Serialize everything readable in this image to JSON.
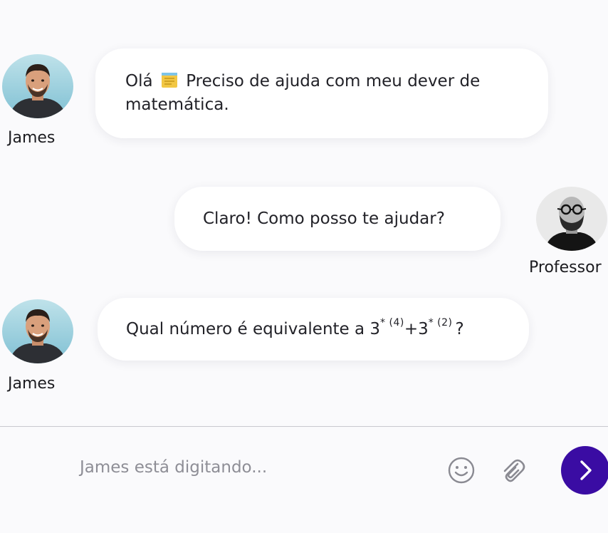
{
  "colors": {
    "background": "#fafafc",
    "bubble": "#ffffff",
    "send_button": "#3a0ca3",
    "placeholder": "#8e8e96"
  },
  "messages": [
    {
      "sender": "James",
      "avatar_icon": "james-avatar",
      "text_before": "Olá",
      "emoji_icon": "memo-emoji",
      "text_after": "Preciso de ajuda com meu dever de matemática."
    },
    {
      "sender": "Professor",
      "avatar_icon": "professor-avatar",
      "text": "Claro! Como posso te ajudar?"
    },
    {
      "sender": "James",
      "avatar_icon": "james-avatar",
      "text_prefix": "Qual número é equivalente a 3",
      "exp1": "* (4)",
      "text_mid": "+3",
      "exp2": "* (2)",
      "text_suffix": "?"
    }
  ],
  "composer": {
    "typing_status": "James está digitando...",
    "emoji_icon": "smiley-icon",
    "attach_icon": "paperclip-icon",
    "send_icon": "chevron-right-icon"
  }
}
